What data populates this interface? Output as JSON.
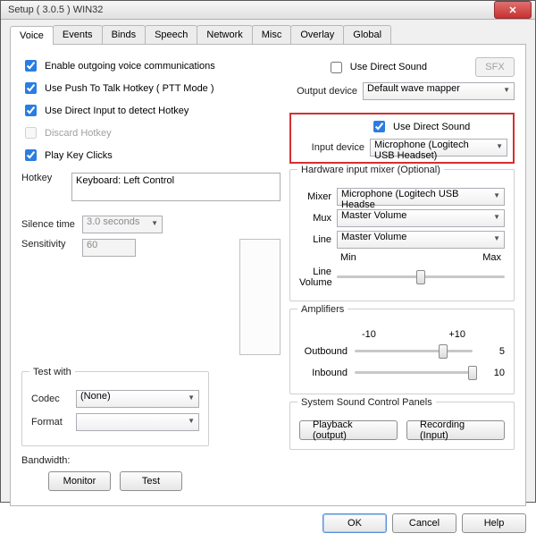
{
  "window": {
    "title": "Setup ( 3.0.5 ) WIN32"
  },
  "tabs": [
    "Voice",
    "Events",
    "Binds",
    "Speech",
    "Network",
    "Misc",
    "Overlay",
    "Global"
  ],
  "active_tab": 0,
  "left": {
    "enable_outgoing": "Enable outgoing voice communications",
    "use_ptt": "Use Push To Talk Hotkey ( PTT Mode )",
    "use_directinput": "Use Direct Input to detect Hotkey",
    "discard_hotkey": "Discard Hotkey",
    "play_key_clicks": "Play Key Clicks",
    "hotkey_label": "Hotkey",
    "hotkey_value": "Keyboard: Left Control",
    "silence_label": "Silence time",
    "silence_value": "3.0 seconds",
    "sensitivity_label": "Sensitivity",
    "sensitivity_value": "60",
    "testwith": {
      "legend": "Test with",
      "codec_label": "Codec",
      "codec_value": "(None)",
      "format_label": "Format",
      "format_value": ""
    },
    "bandwidth_label": "Bandwidth:",
    "monitor_btn": "Monitor",
    "test_btn": "Test"
  },
  "right": {
    "use_direct_sound_out": "Use Direct Sound",
    "sfx_btn": "SFX",
    "output_device_label": "Output device",
    "output_device_value": "Default wave mapper",
    "use_direct_sound_in": "Use Direct Sound",
    "input_device_label": "Input device",
    "input_device_value": "Microphone (Logitech USB Headset)",
    "hw_mixer": {
      "legend": "Hardware input mixer (Optional)",
      "mixer_label": "Mixer",
      "mixer_value": "Microphone (Logitech USB Headse",
      "mux_label": "Mux",
      "mux_value": "Master Volume",
      "line_label": "Line",
      "line_value": "Master Volume",
      "min_label": "Min",
      "max_label": "Max",
      "line_volume_label": "Line\nVolume"
    },
    "amplifiers": {
      "legend": "Amplifiers",
      "left_scale": "-10",
      "right_scale": "+10",
      "outbound_label": "Outbound",
      "outbound_value": "5",
      "inbound_label": "Inbound",
      "inbound_value": "10"
    },
    "sscp": {
      "legend": "System Sound Control Panels",
      "playback_btn": "Playback (output)",
      "recording_btn": "Recording (Input)"
    }
  },
  "footer": {
    "ok": "OK",
    "cancel": "Cancel",
    "help": "Help"
  }
}
